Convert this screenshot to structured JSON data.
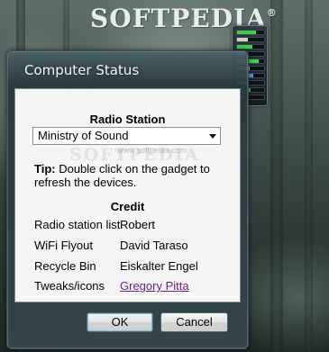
{
  "desktop": {
    "watermark": "SOFTPEDIA",
    "watermark_mark": "®"
  },
  "dialog": {
    "title": "Computer Status",
    "radio_section_title": "Radio Station",
    "radio_selected": "Ministry of Sound",
    "watermark_url": "www.softpedia.com",
    "watermark_text": "SOFTPEDIA",
    "tip_label": "Tip:",
    "tip_text": " Double click on the gadget to refresh the devices.",
    "credit_title": "Credit",
    "credits": [
      {
        "label": "Radio station list",
        "value": "Robert"
      },
      {
        "label": "WiFi Flyout",
        "value": "David Taraso"
      },
      {
        "label": "Recycle Bin",
        "value": "Eiskalter Engel"
      },
      {
        "label": "Tweaks/icons",
        "value": "Gregory Pitta"
      }
    ],
    "ok_label": "OK",
    "cancel_label": "Cancel"
  },
  "gadget": {
    "bars": [
      {
        "fill": 0.7,
        "color": "#3fd04a"
      },
      {
        "fill": 0.4,
        "color": "#d0d0d0"
      },
      {
        "fill": 0.55,
        "color": "#3fd04a"
      },
      {
        "fill": 0.3,
        "color": "#d0d0d0"
      },
      {
        "fill": 0.8,
        "color": "#3fd04a"
      },
      {
        "fill": 0.45,
        "color": "#d0d0d0"
      },
      {
        "fill": 0.6,
        "color": "#4aa0e6"
      },
      {
        "fill": 0.35,
        "color": "#d0d0d0"
      },
      {
        "fill": 0.5,
        "color": "#3fd04a"
      },
      {
        "fill": 0.25,
        "color": "#d0d0d0"
      }
    ]
  },
  "colors": {
    "link": "#6b1f8a",
    "accent": "#6cc3e8"
  }
}
